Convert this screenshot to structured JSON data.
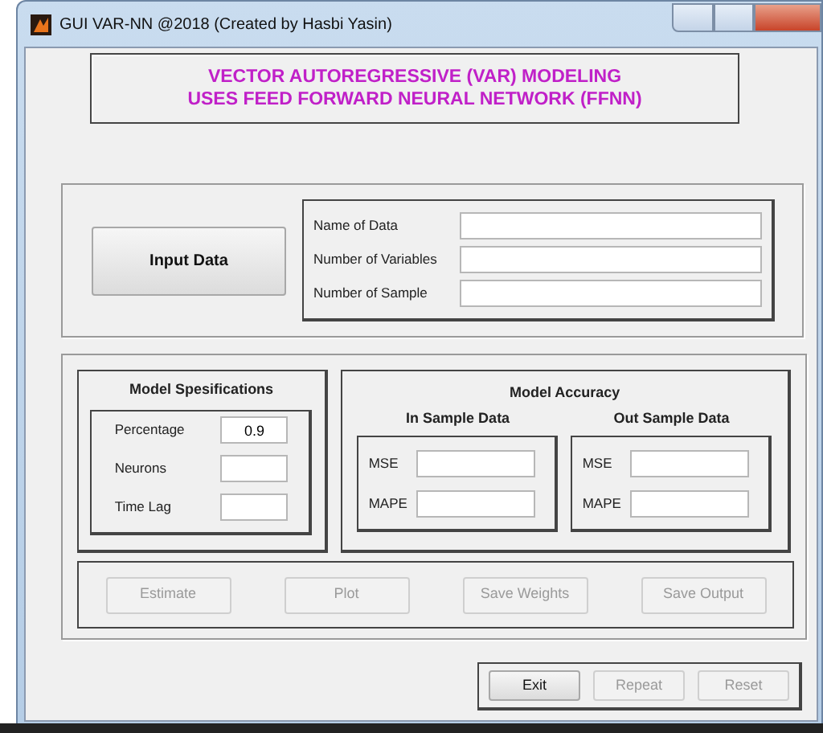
{
  "window": {
    "title": "GUI VAR-NN @2018 (Created by Hasbi Yasin)"
  },
  "header": {
    "lines": [
      "VECTOR AUTOREGRESSIVE (VAR) MODELING",
      "USES FEED FORWARD NEURAL NETWORK (FFNN)"
    ]
  },
  "input_panel": {
    "button": {
      "label": "Input Data",
      "disabled": false
    },
    "fields": [
      {
        "label": "Name of Data"
      },
      {
        "label": "Number of Variables"
      },
      {
        "label": "Number of Sample"
      }
    ]
  },
  "model_specifications": {
    "title": "Model Spesifications",
    "fields": [
      {
        "label": "Percentage",
        "value": "0.9"
      },
      {
        "label": "Neurons"
      },
      {
        "label": "Time Lag"
      }
    ]
  },
  "model_accuracy": {
    "title": "Model Accuracy",
    "groups": [
      {
        "title": "In Sample Data",
        "fields": [
          {
            "label": "MSE"
          },
          {
            "label": "MAPE"
          }
        ]
      },
      {
        "title": "Out Sample Data",
        "fields": [
          {
            "label": "MSE"
          },
          {
            "label": "MAPE"
          }
        ]
      }
    ]
  },
  "action_buttons": [
    {
      "label": "Estimate",
      "disabled": true
    },
    {
      "label": "Plot",
      "disabled": true
    },
    {
      "label": "Save Weights",
      "disabled": true
    },
    {
      "label": "Save Output",
      "disabled": true
    }
  ],
  "bottom_buttons": [
    {
      "label": "Exit",
      "disabled": false
    },
    {
      "label": "Repeat",
      "disabled": true
    },
    {
      "label": "Reset",
      "disabled": true
    }
  ]
}
